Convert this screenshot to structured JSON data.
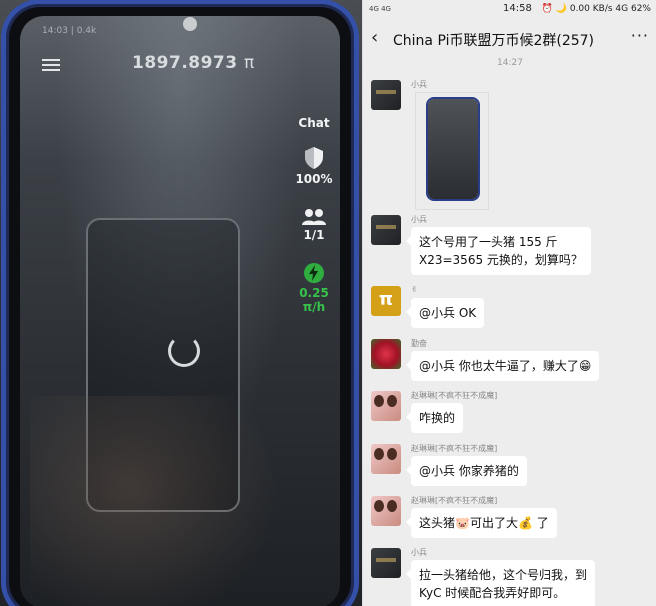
{
  "photo": {
    "phone_status": "14:03 | 0.4k",
    "balance": "1897.8973",
    "balance_unit": "π",
    "chat_label": "Chat",
    "security_percent": "100%",
    "team_count": "1/1",
    "mining_rate": "0.25",
    "mining_unit": "π/h"
  },
  "chat": {
    "status": {
      "signal": "4G 4G",
      "time": "14:58",
      "icons": "⏰ 🌙 0.00 KB/s 4G",
      "battery": "62%"
    },
    "header": {
      "back_icon": "‹",
      "title": "China Pi币联盟万币候2群(257)",
      "more_icon": "···"
    },
    "timestamp": "14:27",
    "messages": [
      {
        "sender": "小兵",
        "avatar": "dark",
        "type": "image"
      },
      {
        "sender": "小兵",
        "avatar": "dark",
        "lines": [
          "这个号用了一头猪 155 斤",
          "X23=3565 元换的，划算吗？"
        ]
      },
      {
        "sender": "✌",
        "avatar": "coin",
        "lines": [
          "@小兵  OK"
        ]
      },
      {
        "sender": "勤奋",
        "avatar": "rose",
        "lines": [
          "@小兵  你也太牛逼了，赚大了"
        ],
        "emoji": "😁"
      },
      {
        "sender": "赵琳琳[不疯不狂不成魔]",
        "avatar": "girls",
        "lines": [
          "咋换的"
        ]
      },
      {
        "sender": "赵琳琳[不疯不狂不成魔]",
        "avatar": "girls",
        "lines": [
          "@小兵  你家养猪的"
        ]
      },
      {
        "sender": "赵琳琳[不疯不狂不成魔]",
        "avatar": "girls",
        "line_a": "这头猪",
        "emoji_a": "🐷",
        "line_b": "可出了大",
        "emoji_b": "💰",
        "line_c": " 了"
      },
      {
        "sender": "小兵",
        "avatar": "dark",
        "lines": [
          "拉一头猪给他，这个号归我，到",
          "KyC 时候配合我弄好即可。"
        ]
      }
    ]
  }
}
